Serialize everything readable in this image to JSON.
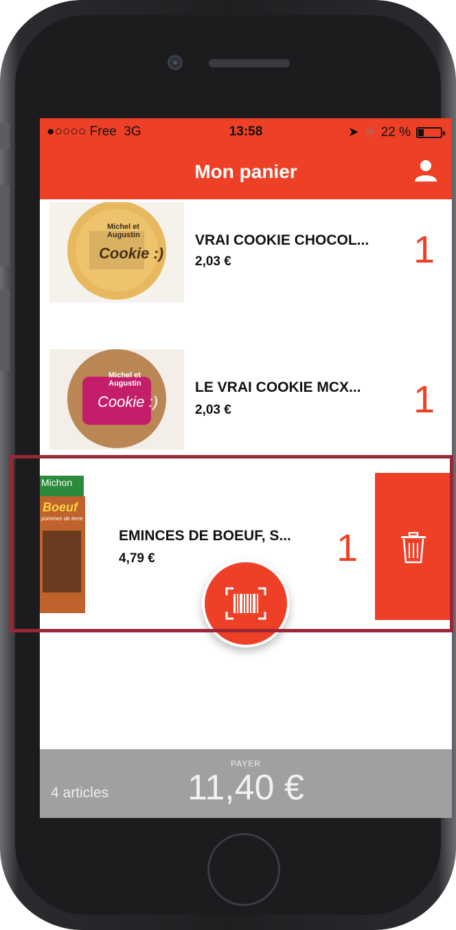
{
  "status": {
    "carrier": "●○○○○ Free",
    "network": "3G",
    "time": "13:58",
    "battery": "22 %"
  },
  "header": {
    "title": "Mon panier",
    "user_icon": "user-icon"
  },
  "cart": {
    "items": [
      {
        "name": "VRAI COOKIE CHOCOL...",
        "price": "2,03 €",
        "quantity": "1",
        "thumb_text": [
          "Michel et",
          "Augustin",
          "Cookie :)"
        ]
      },
      {
        "name": "LE VRAI COOKIE MCX...",
        "price": "2,03 €",
        "quantity": "1",
        "thumb_text": [
          "Michel et",
          "Augustin",
          "Cookie :)"
        ]
      },
      {
        "name": "EMINCES DE BOEUF, S...",
        "price": "4,79 €",
        "quantity": "1",
        "thumb_text": [
          "Michon",
          "Boeuf",
          "pommes de terre"
        ]
      }
    ],
    "delete_icon": "trash-icon"
  },
  "scan_button": {
    "icon": "barcode-icon"
  },
  "footer": {
    "count": "4 articles",
    "pay_label": "PAYER",
    "total": "11,40 €"
  },
  "colors": {
    "accent": "#ee4026",
    "highlight": "#9b2735",
    "footer": "#a0a0a0"
  }
}
